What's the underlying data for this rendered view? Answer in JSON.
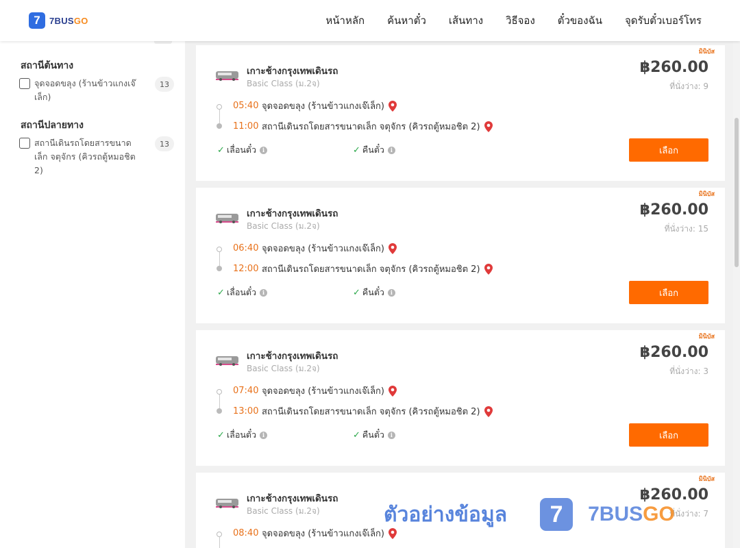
{
  "header": {
    "logo_mark": "7",
    "logo_text_a": "7BUS",
    "logo_text_b": "GO",
    "nav": [
      "หน้าหลัก",
      "ค้นหาตั๋ว",
      "เส้นทาง",
      "วิธีจอง",
      "ตั๋วของฉัน",
      "จุดรับตั๋วเบอร์โทร"
    ]
  },
  "filters": {
    "origin_title": "สถานีต้นทาง",
    "origin_option": "จุดจอดขลุง (ร้านข้าวแกงเจ๊เล็ก)",
    "origin_count": "13",
    "destination_title": "สถานีปลายทาง",
    "destination_option": "สถานีเดินรถโดยสารขนาดเล็ก จตุจักร (คิวรถตู้หมอชิต 2)",
    "destination_count": "13"
  },
  "trips": [
    {
      "tag": "มินิบัส",
      "route": "เกาะช้างกรุงเทพเดินรถ",
      "class": "Basic Class (ม.2จ)",
      "price": "฿260.00",
      "seats": "ที่นั่งว่าง: 9",
      "dep_time": "05:40",
      "dep_stop": "จุดจอดขลุง (ร้านข้าวแกงเจ๊เล็ก)",
      "arr_time": "11:00",
      "arr_stop": "สถานีเดินรถโดยสารขนาดเล็ก จตุจักร (คิวรถตู้หมอชิต 2)",
      "feature1": "เลื่อนตั๋ว",
      "feature2": "คืนตั๋ว",
      "button": "เลือก"
    },
    {
      "tag": "มินิบัส",
      "route": "เกาะช้างกรุงเทพเดินรถ",
      "class": "Basic Class (ม.2จ)",
      "price": "฿260.00",
      "seats": "ที่นั่งว่าง: 15",
      "dep_time": "06:40",
      "dep_stop": "จุดจอดขลุง (ร้านข้าวแกงเจ๊เล็ก)",
      "arr_time": "12:00",
      "arr_stop": "สถานีเดินรถโดยสารขนาดเล็ก จตุจักร (คิวรถตู้หมอชิต 2)",
      "feature1": "เลื่อนตั๋ว",
      "feature2": "คืนตั๋ว",
      "button": "เลือก"
    },
    {
      "tag": "มินิบัส",
      "route": "เกาะช้างกรุงเทพเดินรถ",
      "class": "Basic Class (ม.2จ)",
      "price": "฿260.00",
      "seats": "ที่นั่งว่าง: 3",
      "dep_time": "07:40",
      "dep_stop": "จุดจอดขลุง (ร้านข้าวแกงเจ๊เล็ก)",
      "arr_time": "13:00",
      "arr_stop": "สถานีเดินรถโดยสารขนาดเล็ก จตุจักร (คิวรถตู้หมอชิต 2)",
      "feature1": "เลื่อนตั๋ว",
      "feature2": "คืนตั๋ว",
      "button": "เลือก"
    },
    {
      "tag": "มินิบัส",
      "route": "เกาะช้างกรุงเทพเดินรถ",
      "class": "Basic Class (ม.2จ)",
      "price": "฿260.00",
      "seats": "ที่นั่งว่าง: 7",
      "dep_time": "08:40",
      "dep_stop": "จุดจอดขลุง (ร้านข้าวแกงเจ๊เล็ก)",
      "arr_time": "",
      "arr_stop": "",
      "feature1": "",
      "feature2": "",
      "button": ""
    }
  ],
  "watermark": {
    "text": "ตัวอย่างข้อมูล",
    "logo_mark": "7",
    "brand_a": "7BUS",
    "brand_b": "GO"
  },
  "colors": {
    "accent": "#ff6a00",
    "time": "#e8711a",
    "brand_blue": "#2f6de1",
    "check": "#2ba84a",
    "pin": "#e03a3a"
  }
}
